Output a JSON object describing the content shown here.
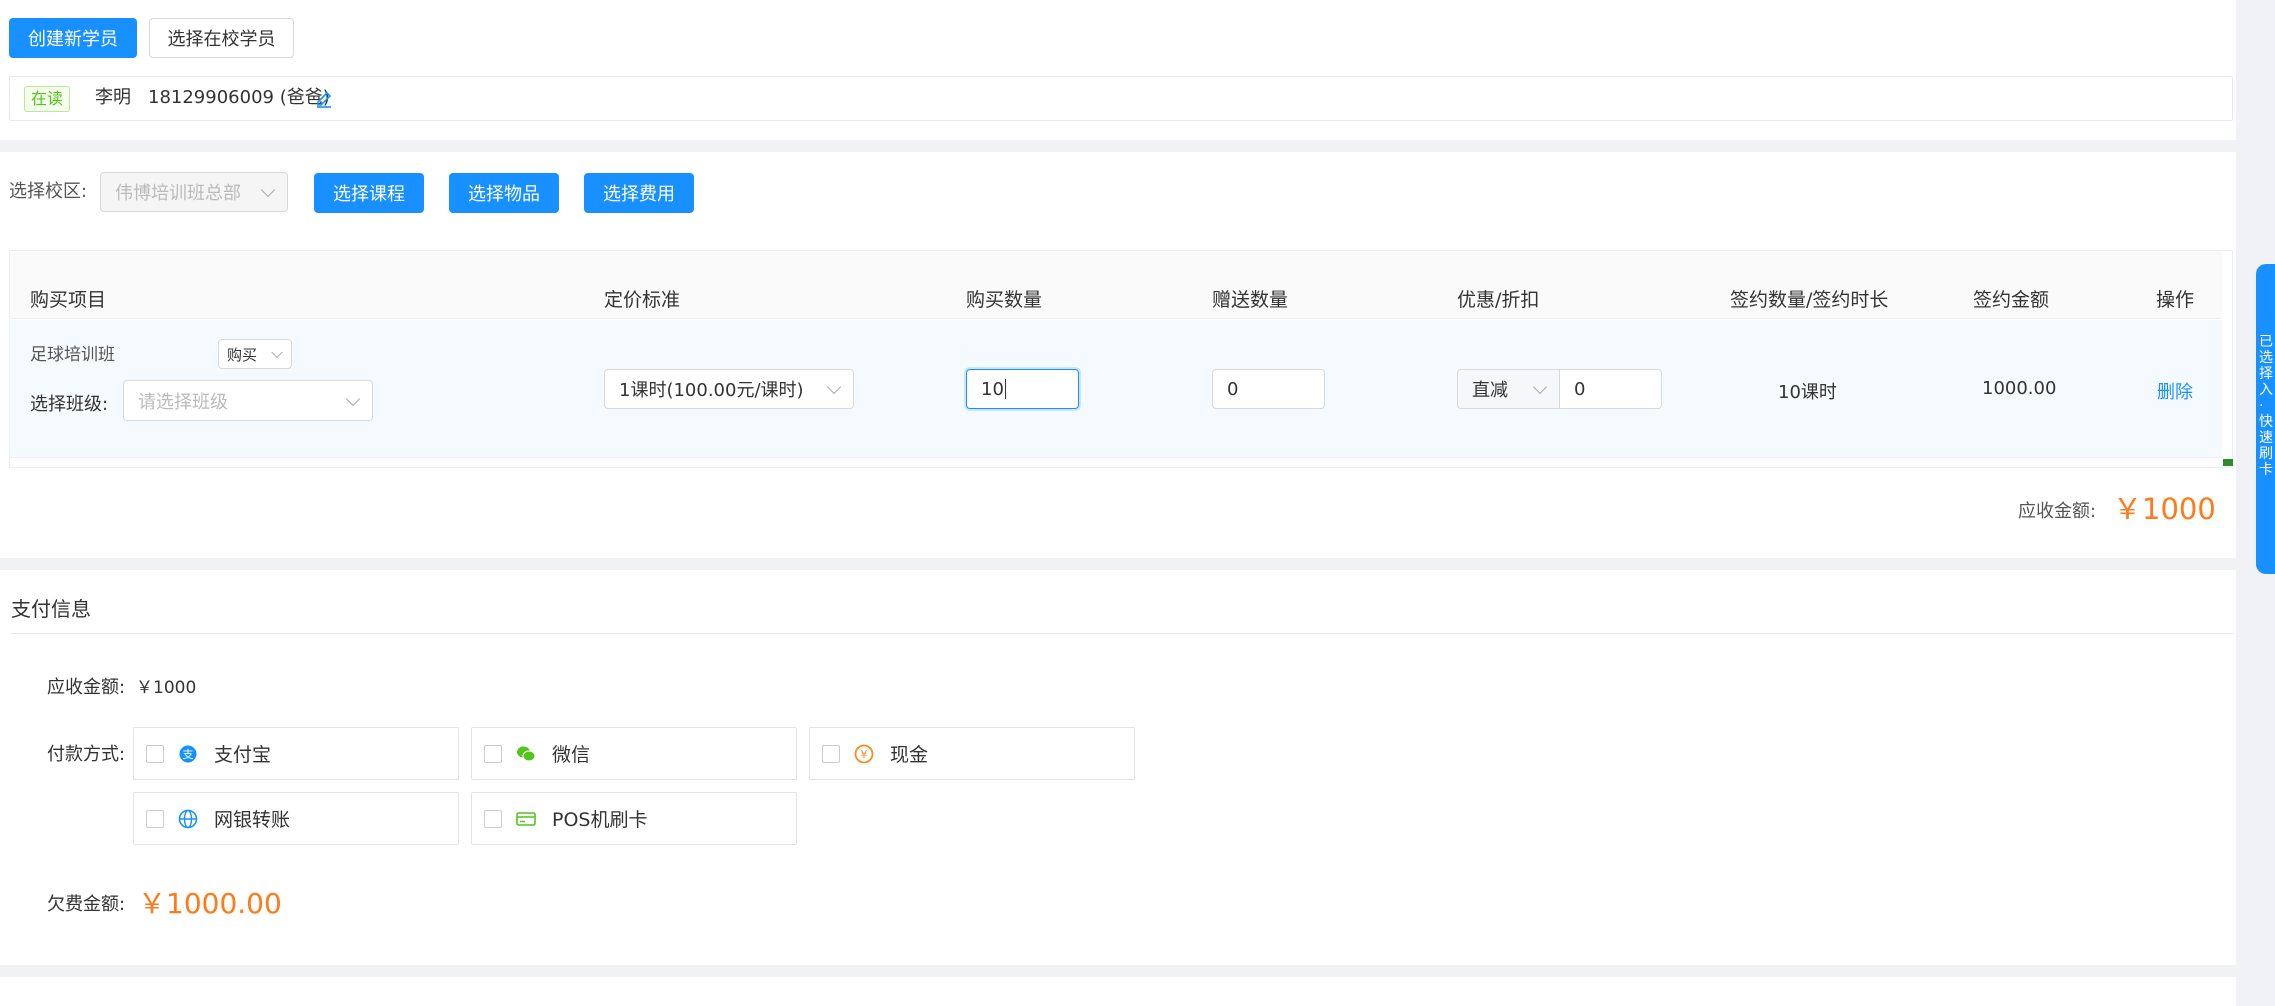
{
  "top": {
    "create_btn": "创建新学员",
    "select_btn": "选择在校学员"
  },
  "student": {
    "status": "在读",
    "name": "李明",
    "phone": "18129906009 (爸爸)"
  },
  "campus": {
    "label": "选择校区:",
    "value": "伟博培训班总部",
    "btn_course": "选择课程",
    "btn_goods": "选择物品",
    "btn_fee": "选择费用"
  },
  "table": {
    "headers": [
      "购买项目",
      "定价标准",
      "购买数量",
      "赠送数量",
      "优惠/折扣",
      "签约数量/签约时长",
      "签约金额",
      "操作"
    ],
    "row": {
      "course_name": "足球培训班",
      "buy_type": "购买",
      "class_label": "选择班级:",
      "class_placeholder": "请选择班级",
      "pricing": "1课时(100.00元/课时)",
      "quantity": "10",
      "gift": "0",
      "discount_type": "直减",
      "discount_value": "0",
      "signed_qty": "10课时",
      "signed_amount": "1000.00",
      "action": "删除"
    }
  },
  "receivable": {
    "label": "应收金额:",
    "value": "￥1000"
  },
  "payment": {
    "section_title": "支付信息",
    "receivable_label": "应收金额:",
    "receivable_value": "￥1000",
    "method_label": "付款方式:",
    "methods": [
      {
        "name": "支付宝",
        "icon": "alipay-icon",
        "color": "#1890ff"
      },
      {
        "name": "微信",
        "icon": "wechat-icon",
        "color": "#52c41a"
      },
      {
        "name": "现金",
        "icon": "cash-icon",
        "color": "#fa8c16"
      },
      {
        "name": "网银转账",
        "icon": "bank-transfer-icon",
        "color": "#1890ff"
      },
      {
        "name": "POS机刷卡",
        "icon": "pos-card-icon",
        "color": "#52c41a"
      }
    ],
    "debt_label": "欠费金额:",
    "debt_value": "￥1000.00"
  },
  "side_tab": {
    "text": "已选择入·快速刷卡"
  },
  "colors": {
    "primary": "#1890ff",
    "accent_orange": "#ff7a1a",
    "status_green": "#52c41a"
  }
}
